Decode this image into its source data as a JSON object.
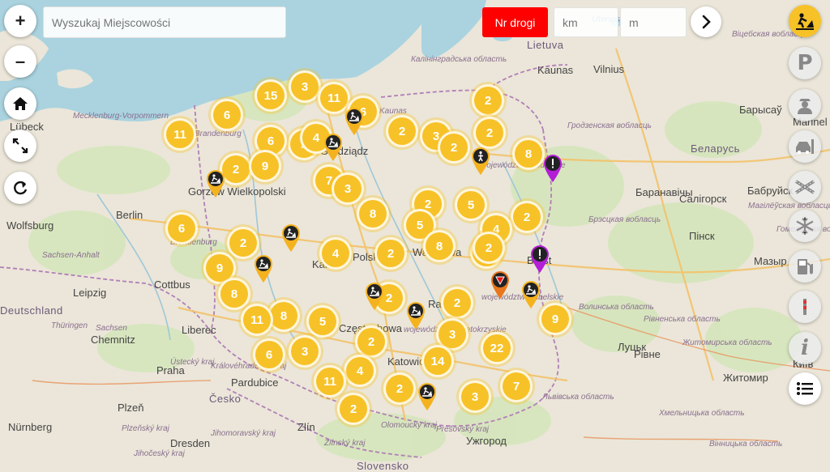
{
  "search": {
    "placeholder": "Wyszukaj Miejscowości"
  },
  "road_filter": {
    "button_label": "Nr drogi",
    "km_placeholder": "km",
    "m_placeholder": "m"
  },
  "left_controls": [
    {
      "name": "zoom-in-button",
      "glyph": "+"
    },
    {
      "name": "zoom-out-button",
      "glyph": "–"
    },
    {
      "name": "home-button",
      "icon": "home-icon"
    },
    {
      "name": "fullscreen-button",
      "icon": "expand-icon"
    },
    {
      "name": "refresh-button",
      "icon": "refresh-icon"
    }
  ],
  "right_controls": [
    {
      "name": "roadworks-layer-button",
      "icon": "roadworks-icon",
      "active": true
    },
    {
      "name": "parking-layer-button",
      "icon": "parking-icon",
      "glyph": "P"
    },
    {
      "name": "police-layer-button",
      "icon": "police-icon"
    },
    {
      "name": "traffic-layer-button",
      "icon": "traffic-icon"
    },
    {
      "name": "roads-layer-button",
      "icon": "road-junction-icon"
    },
    {
      "name": "winter-layer-button",
      "icon": "snowflake-icon"
    },
    {
      "name": "fuel-layer-button",
      "icon": "fuel-pump-icon"
    },
    {
      "name": "border-layer-button",
      "icon": "border-post-icon"
    },
    {
      "name": "info-layer-button",
      "icon": "info-icon",
      "glyph": "i"
    },
    {
      "name": "list-button",
      "icon": "list-icon"
    }
  ],
  "map_labels": {
    "countries": [
      "Lietuva",
      "Беларусь",
      "Deutschland",
      "Česko",
      "Slovensko"
    ],
    "cities": [
      "Berlin",
      "Leipzig",
      "Chemnitz",
      "Dresden",
      "Praha",
      "Plzeň",
      "Liberec",
      "Cottbus",
      "Wolfsburg",
      "Nürnberg",
      "Kaunas",
      "Vilnius",
      "Барысаў",
      "Баранавічы",
      "Салігорск",
      "Бабруйск",
      "Мазыр",
      "Пінск",
      "Луцьк",
      "Рівне",
      "Житомир",
      "Київ",
      "Lübeck",
      "Marinel",
      "Ужгород",
      "Pardubice",
      "Zlín",
      "Polska",
      "Warszawa",
      "Radom",
      "Brest",
      "Gorzów Wielkopolski",
      "Częstochowa",
      "Katowice",
      "Kalisz",
      "Grudziądz"
    ],
    "regions": [
      "Mecklenburg-Vorpommern",
      "Sachsen-Anhalt",
      "Sachsen",
      "Thüringen",
      "Brandenburg",
      "Brandenburg",
      "Гродзенская вобласць",
      "Брэсцкая вобласць",
      "Волинська область",
      "Рівненська область",
      "Житомирська область",
      "Львівська область",
      "Хмельницька область",
      "Вінницька область",
      "Віцебская вобласць",
      "Магілёўская вобласць",
      "Гомельская вобласць",
      "Калінінградська область",
      "Kaunas",
      "województwo lubelskie",
      "województwo świętokrzyskie",
      "województwo podlaskie",
      "Prešovský kraj",
      "Jihomoravský kraj",
      "Zlínský kraj",
      "Olomoucký kraj",
      "Jihočeský kraj",
      "Plzeňský kraj",
      "Královéhradecký kraj",
      "Ústecký kraj"
    ],
    "water": [
      "Utenos"
    ]
  },
  "clusters": [
    {
      "count": "3"
    },
    {
      "count": "15"
    },
    {
      "count": "11"
    },
    {
      "count": "2"
    },
    {
      "count": "6"
    },
    {
      "count": "11"
    },
    {
      "count": "6"
    },
    {
      "count": "2"
    },
    {
      "count": "3"
    },
    {
      "count": "2"
    },
    {
      "count": "6"
    },
    {
      "count": "2"
    },
    {
      "count": "2"
    },
    {
      "count": "4"
    },
    {
      "count": "8"
    },
    {
      "count": "2"
    },
    {
      "count": "9"
    },
    {
      "count": "7"
    },
    {
      "count": "3"
    },
    {
      "count": "2"
    },
    {
      "count": "8"
    },
    {
      "count": "5"
    },
    {
      "count": "2"
    },
    {
      "count": "6"
    },
    {
      "count": "4"
    },
    {
      "count": "5"
    },
    {
      "count": "2"
    },
    {
      "count": "8"
    },
    {
      "count": "4"
    },
    {
      "count": "2"
    },
    {
      "count": "9"
    },
    {
      "count": "4"
    },
    {
      "count": "2"
    },
    {
      "count": "8"
    },
    {
      "count": "8"
    },
    {
      "count": "2"
    },
    {
      "count": "2"
    },
    {
      "count": "11"
    },
    {
      "count": "5"
    },
    {
      "count": "9"
    },
    {
      "count": "3"
    },
    {
      "count": "3"
    },
    {
      "count": "2"
    },
    {
      "count": "22"
    },
    {
      "count": "6"
    },
    {
      "count": "14"
    },
    {
      "count": "4"
    },
    {
      "count": "11"
    },
    {
      "count": "2"
    },
    {
      "count": "7"
    },
    {
      "count": "3"
    },
    {
      "count": "2"
    }
  ],
  "pins": [
    {
      "type": "roadworks"
    },
    {
      "type": "roadworks"
    },
    {
      "type": "roadworks"
    },
    {
      "type": "roadworks"
    },
    {
      "type": "roadworks"
    },
    {
      "type": "roadworks"
    },
    {
      "type": "roadworks"
    },
    {
      "type": "roadworks"
    },
    {
      "type": "roadworks"
    },
    {
      "type": "pedestrian"
    },
    {
      "type": "warning"
    },
    {
      "type": "warning"
    },
    {
      "type": "yield"
    }
  ],
  "colors": {
    "cluster": "#f7c227",
    "nr_button": "#ff0000",
    "warning_pin": "#b31fd6",
    "yield_pin": "#e8761c",
    "roadworks_pin": "#f4b21f",
    "sea": "#aad3df",
    "land": "#e9e6dc"
  }
}
